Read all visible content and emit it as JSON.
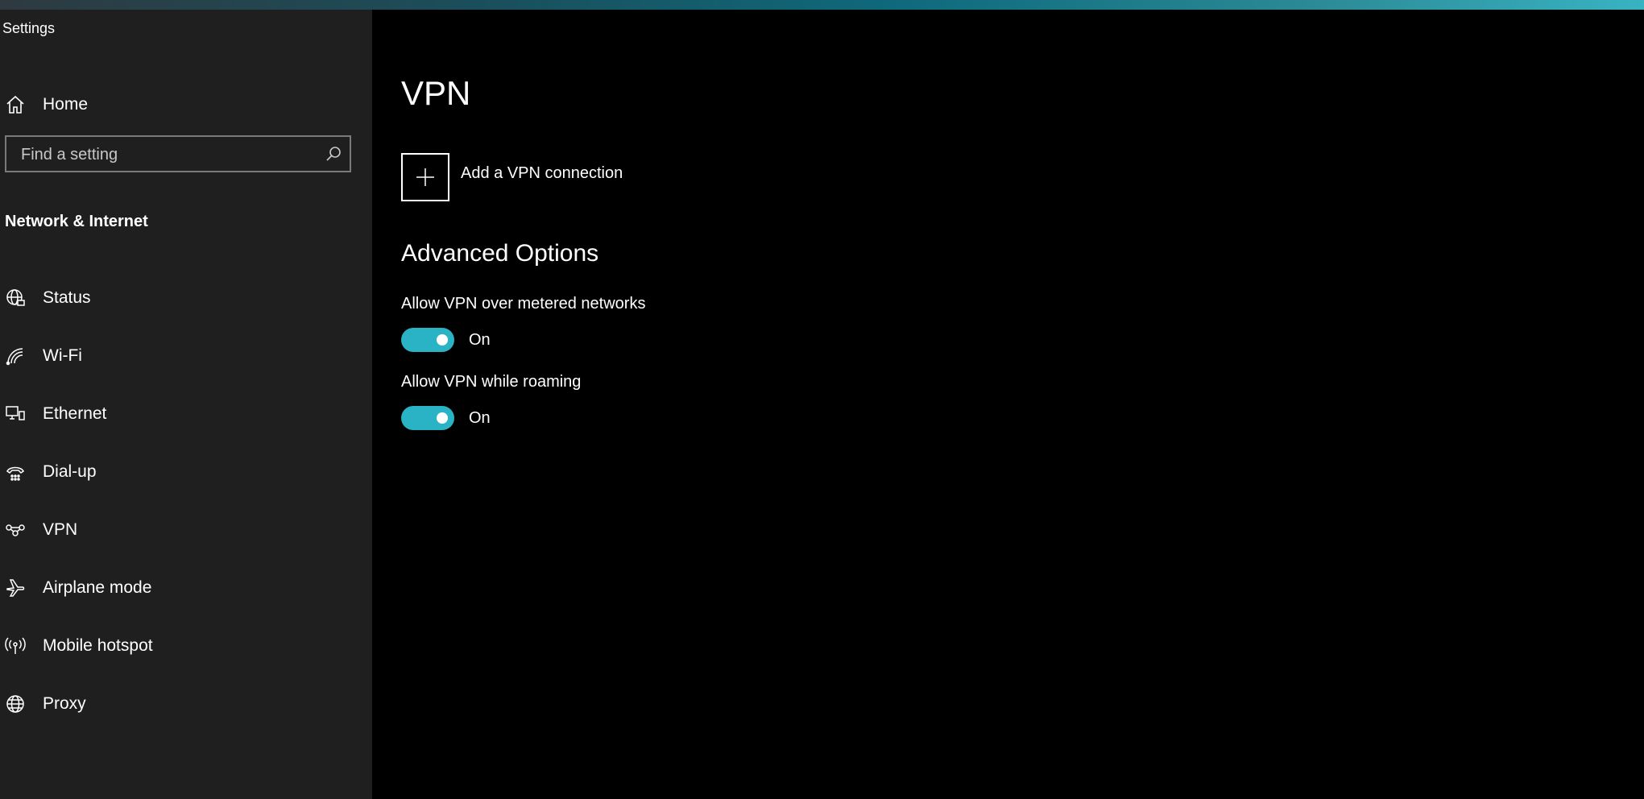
{
  "app": {
    "title": "Settings"
  },
  "sidebar": {
    "home_label": "Home",
    "search_placeholder": "Find a setting",
    "section_title": "Network & Internet",
    "items": [
      {
        "label": "Status",
        "icon": "globe-network-icon"
      },
      {
        "label": "Wi-Fi",
        "icon": "wifi-icon"
      },
      {
        "label": "Ethernet",
        "icon": "ethernet-icon"
      },
      {
        "label": "Dial-up",
        "icon": "dialup-icon"
      },
      {
        "label": "VPN",
        "icon": "vpn-icon"
      },
      {
        "label": "Airplane mode",
        "icon": "airplane-icon"
      },
      {
        "label": "Mobile hotspot",
        "icon": "hotspot-icon"
      },
      {
        "label": "Proxy",
        "icon": "globe-icon"
      }
    ]
  },
  "main": {
    "title": "VPN",
    "add_vpn_label": "Add a VPN connection",
    "advanced_title": "Advanced Options",
    "options": [
      {
        "label": "Allow VPN over metered networks",
        "state": "On"
      },
      {
        "label": "Allow VPN while roaming",
        "state": "On"
      }
    ]
  },
  "colors": {
    "accent": "#29b3c4",
    "sidebar_bg": "#1f1f1f",
    "main_bg": "#000000"
  }
}
